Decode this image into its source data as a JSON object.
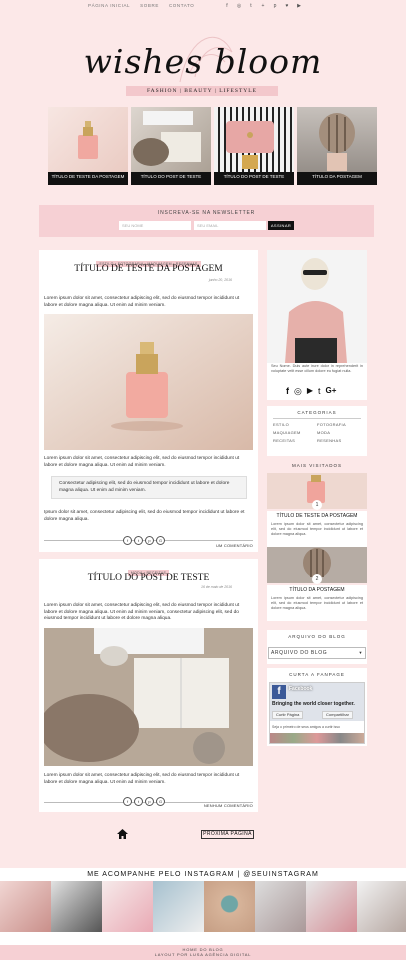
{
  "topnav": {
    "links": [
      "PÁGINA INICIAL",
      "SOBRE",
      "CONTATO"
    ],
    "social_icons": [
      "facebook-icon",
      "instagram-icon",
      "twitter-icon",
      "googleplus-icon",
      "pinterest-icon",
      "bloglovin-icon",
      "youtube-icon"
    ]
  },
  "header": {
    "title": "wishes bloom",
    "tagline": "FASHION | BEAUTY | LIFESTYLE"
  },
  "featured": [
    {
      "caption": "TÍTULO DE TESTE DA POSTAGEM"
    },
    {
      "caption": "TÍTULO DO POST DE TESTE"
    },
    {
      "caption": "TÍTULO DO POST DE TESTE"
    },
    {
      "caption": "TÍTULO DA POSTAGEM"
    }
  ],
  "newsletter": {
    "title": "INSCREVA-SE NA NEWSLETTER",
    "name_placeholder": "SEU NOME",
    "email_placeholder": "SEU EMAIL",
    "button": "ASSINAR"
  },
  "posts": [
    {
      "categories": "ESTILO • FOTOGRAFIA • MAQUIAGEM • RESENHAS",
      "title": "TÍTULO DE TESTE DA POSTAGEM",
      "date": "junho 20, 2016",
      "p1": "Lorem ipsum dolor sit amet, consectetur adipiscing elit, sed do eiusmod tempor incididunt ut labore et dolore magna aliqua. Ut enim ad minim veniam.",
      "p2": "Lorem ipsum dolor sit amet, consectetur adipiscing elit, sed do eiusmod tempor incididunt ut labore et dolore magna aliqua. Ut enim ad minim veniam.",
      "quote": "Consectetur adipiscing elit, sed do eiusmod tempor incididunt ut labore et dolore magna aliqua. Ut enim ad minim veniam.",
      "p3": "Ipsum dolor sit amet, consectetur adipiscing elit, sed do eiusmod tempor incididunt ut labore et dolore magna aliqua.",
      "comments": "UM COMENTÁRIO"
    },
    {
      "categories": "MODA • RECEITAS",
      "title": "TÍTULO DO POST DE TESTE",
      "date": "16 de maio de 2016",
      "p1": "Lorem ipsum dolor sit amet, consectetur adipiscing elit, sed do eiusmod tempor incididunt ut labore et dolore magna aliqua. Ut enim ad minim veniam, consectetur adipiscing elit, sed do eiusmod tempor incididunt ut labore et dolore magna aliqua.",
      "p2": "Lorem ipsum dolor sit amet, consectetur adipiscing elit, sed do eiusmod tempor incididunt ut labore et dolore magna aliqua. Ut enim ad minim veniam.",
      "comments": "NENHUM COMENTÁRIO"
    }
  ],
  "share_icons": [
    "facebook-icon",
    "twitter-icon",
    "pinterest-icon",
    "googleplus-icon"
  ],
  "sidebar": {
    "about": "Seu Nome. Duis aute irure dolor in reprehenderit in voluptate velit esse cillum dolore eu fugiat nulla.",
    "social_icons": [
      "facebook-icon",
      "instagram-icon",
      "youtube-icon",
      "twitter-icon",
      "googleplus-icon"
    ],
    "categories_title": "CATEGORIAS",
    "categories": [
      "ESTILO",
      "FOTOGRAFIA",
      "MAQUIAGEM",
      "MODA",
      "RECEITAS",
      "RESENHAS"
    ],
    "popular_title": "MAIS VISITADOS",
    "popular": [
      {
        "num": "1",
        "caption": "TÍTULO DE TESTE DA POSTAGEM",
        "excerpt": "Lorem ipsum dolor sit amet, consectetur adipiscing elit, sed do eiusmod tempor incididunt ut labore et dolore magna aliqua."
      },
      {
        "num": "2",
        "caption": "TÍTULO DA POSTAGEM",
        "excerpt": "Lorem ipsum dolor sit amet, consectetur adipiscing elit, sed do eiusmod tempor incididunt ut labore et dolore magna aliqua."
      }
    ],
    "archive_title": "ARQUIVO DO BLOG",
    "archive_select": "ARQUIVO DO BLOG",
    "fanpage_title": "CURTA A FANPAGE",
    "fb_name": "Facebook",
    "fb_tagline": "Bringing the world closer together.",
    "fb_like": "Curtir Página",
    "fb_share": "Compartilhar",
    "fb_friends": "Seja o primeiro de seus amigos a curtir isso"
  },
  "pagination": {
    "next": "PRÓXIMA PÁGINA"
  },
  "instagram": {
    "title": "ME ACOMPANHE PELO INSTAGRAM | @SEUINSTAGRAM"
  },
  "footer": {
    "line1": "HOME DO BLOG",
    "line2": "LAYOUT POR LUSA AGÊNCIA DIGITAL"
  }
}
